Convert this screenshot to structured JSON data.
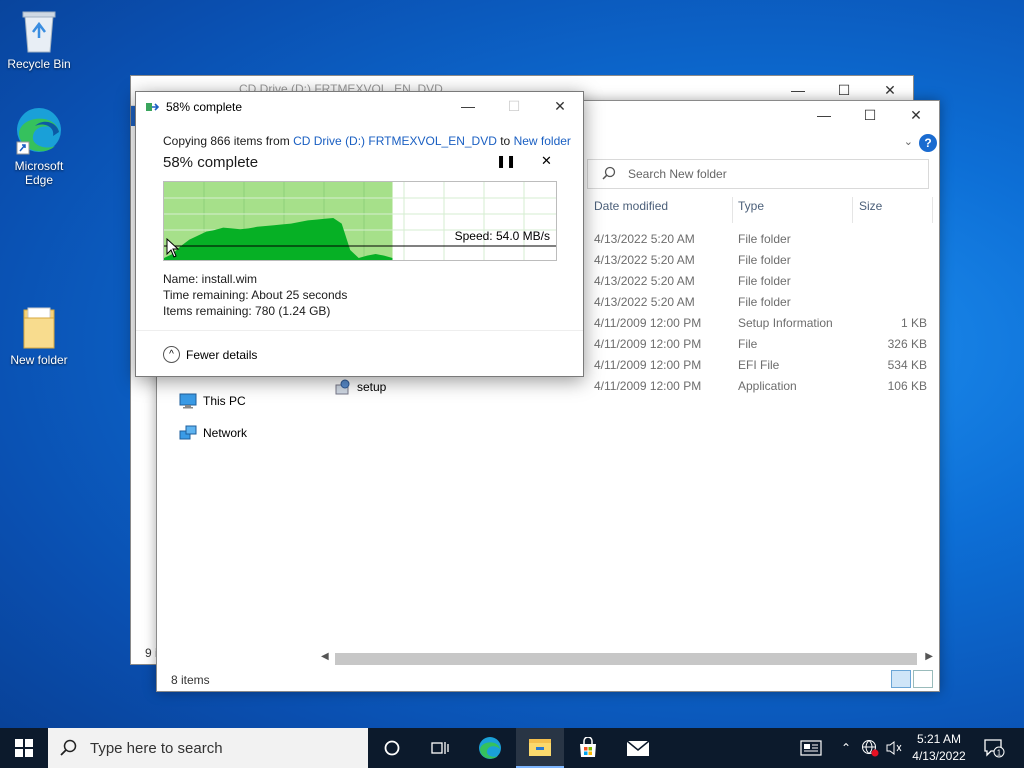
{
  "desktop": {
    "icons": [
      {
        "name": "recycle-bin",
        "label": "Recycle Bin"
      },
      {
        "name": "edge",
        "label_line1": "Microsoft",
        "label_line2": "Edge"
      },
      {
        "name": "new-folder",
        "label": "New folder"
      }
    ]
  },
  "back_window": {
    "title": "CD Drive (D:) FRTMEXVOL_EN_DVD",
    "status": "9 i"
  },
  "explorer": {
    "search_placeholder": "Search New folder",
    "help_label": "?",
    "columns": [
      "Date modified",
      "Type",
      "Size"
    ],
    "rows": [
      {
        "date": "4/13/2022 5:20 AM",
        "type": "File folder",
        "size": ""
      },
      {
        "date": "4/13/2022 5:20 AM",
        "type": "File folder",
        "size": ""
      },
      {
        "date": "4/13/2022 5:20 AM",
        "type": "File folder",
        "size": ""
      },
      {
        "date": "4/13/2022 5:20 AM",
        "type": "File folder",
        "size": ""
      },
      {
        "date": "4/11/2009 12:00 PM",
        "type": "Setup Information",
        "size": "1 KB"
      },
      {
        "date": "4/11/2009 12:00 PM",
        "type": "File",
        "size": "326 KB"
      },
      {
        "date": "4/11/2009 12:00 PM",
        "type": "EFI File",
        "size": "534 KB"
      },
      {
        "date": "4/11/2009 12:00 PM",
        "type": "Application",
        "size": "106 KB"
      }
    ],
    "nav": [
      {
        "label": "This PC",
        "icon": "monitor-icon"
      },
      {
        "label": "Network",
        "icon": "network-icon"
      }
    ],
    "visible_file": "setup",
    "status": "8 items"
  },
  "copy_dialog": {
    "title": "58% complete",
    "copy_prefix": "Copying 866 items from ",
    "source": "CD Drive (D:) FRTMEXVOL_EN_DVD",
    "copy_mid": " to ",
    "destination": "New folder",
    "progress_text": "58% complete",
    "progress": 0.58,
    "speed": "Speed: 54.0 MB/s",
    "name_line": "Name:  install.wim",
    "time_line": "Time remaining:  About 25 seconds",
    "items_line": "Items remaining:  780 (1.24 GB)",
    "fewer_details": "Fewer details",
    "throughput_curve": [
      0.05,
      0.1,
      0.2,
      0.28,
      0.33,
      0.38,
      0.4,
      0.43,
      0.42,
      0.41,
      0.42,
      0.44,
      0.45,
      0.46,
      0.47,
      0.48,
      0.5,
      0.52,
      0.53,
      0.54,
      0.55,
      0.48,
      0.15,
      0.05,
      0.08,
      0.1,
      0.08,
      0.05
    ]
  },
  "taskbar": {
    "search_placeholder": "Type here to search",
    "time": "5:21 AM",
    "date": "4/13/2022",
    "notification_count": "1"
  },
  "colors": {
    "progress_fill": "#a6e08a",
    "graph_fill": "#06b025",
    "link": "#1a5fc2",
    "taskbar": "#0c1a2c"
  }
}
